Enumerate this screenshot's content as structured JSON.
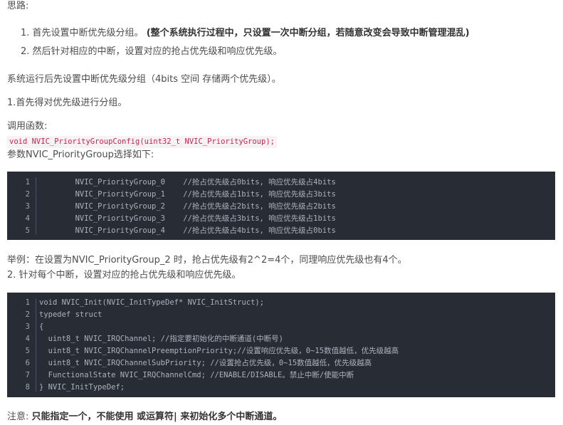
{
  "heading": "思路:",
  "steps": [
    {
      "num": "1.",
      "text": "首先设置中断优先级分组。",
      "bold": "(整个系统执行过程中，只设置一次中断分组，若随意改变会导致中断管理混乱)"
    },
    {
      "num": "2.",
      "text": "然后针对相应的中断，设置对应的抢占优先级和响应优先级。"
    }
  ],
  "para1": "系统运行后先设置中断优先级分组（4bits 空间 存储两个优先级）。",
  "para2": "1.首先得对优先级进行分组。",
  "para3": "调用函数:",
  "inline_code": "void NVIC_PriorityGroupConfig(uint32_t NVIC_PriorityGroup);",
  "para4": "参数NVIC_PriorityGroup选择如下:",
  "code1": [
    {
      "n": "1",
      "code": "        NVIC_PriorityGroup_0    //抢占优先级占0bits, 响应优先级占4bits"
    },
    {
      "n": "2",
      "code": "        NVIC_PriorityGroup_1    //抢占优先级占1bits, 响应优先级占3bits"
    },
    {
      "n": "3",
      "code": "        NVIC_PriorityGroup_2    //抢占优先级占2bits, 响应优先级占2bits"
    },
    {
      "n": "4",
      "code": "        NVIC_PriorityGroup_3    //抢占优先级占3bits, 响应优先级占1bits"
    },
    {
      "n": "5",
      "code": "        NVIC_PriorityGroup_4    //抢占优先级占4bits, 响应优先级占0bits"
    }
  ],
  "para5": "举例：在设置为NVIC_PriorityGroup_2 时，抢占优先级有2^2=4个，同理响应优先级也有4个。",
  "para6": "2. 针对每个中断，设置对应的抢占优先级和响应优先级。",
  "code2": [
    {
      "n": "1",
      "code": "void NVIC_Init(NVIC_InitTypeDef* NVIC_InitStruct);"
    },
    {
      "n": "2",
      "code": "typedef struct"
    },
    {
      "n": "3",
      "code": "{"
    },
    {
      "n": "4",
      "code": "  uint8_t NVIC_IRQChannel; //指定要初始化的中断通道(中断号)"
    },
    {
      "n": "5",
      "code": "  uint8_t NVIC_IRQChannelPreemptionPriority;//设置响应优先级，0~15数值越低，优先级越高"
    },
    {
      "n": "6",
      "code": "  uint8_t NVIC_IRQChannelSubPriority; //设置抢占优先级，0~15数值越低，优先级越高"
    },
    {
      "n": "7",
      "code": "  FunctionalState NVIC_IRQChannelCmd; //ENABLE/DISABLE。禁止中断/使能中断"
    },
    {
      "n": "8",
      "code": "} NVIC_InitTypeDef;"
    }
  ],
  "note_prefix": "注意:",
  "note_bold": "只能指定一个，不能使用 或运算符| 来初始化多个中断通道。",
  "colors": {
    "code_bg": "#282c34",
    "inline_code_fg": "#c7254e",
    "inline_code_bg": "#f9f2f4",
    "text": "#4d4d4d"
  }
}
